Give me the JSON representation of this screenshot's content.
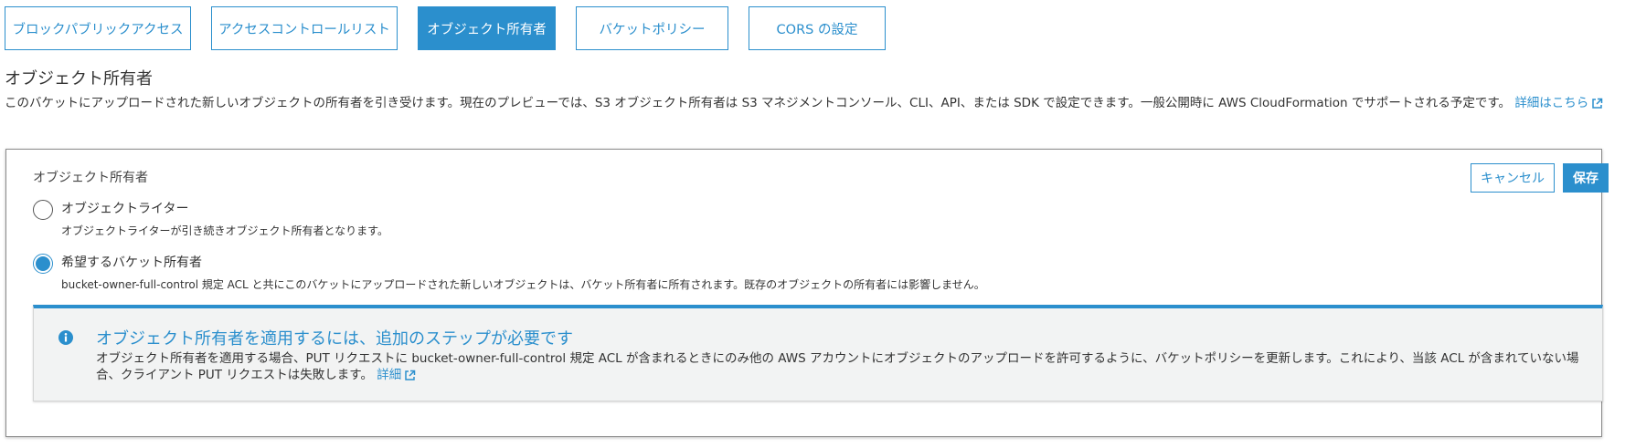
{
  "tabs": [
    {
      "label": "ブロックパブリックアクセス",
      "active": false
    },
    {
      "label": "アクセスコントロールリスト",
      "active": false
    },
    {
      "label": "オブジェクト所有者",
      "active": true
    },
    {
      "label": "バケットポリシー",
      "active": false
    },
    {
      "label": "CORS の設定",
      "active": false
    }
  ],
  "section": {
    "title": "オブジェクト所有者",
    "description": "このバケットにアップロードされた新しいオブジェクトの所有者を引き受けます。現在のプレビューでは、S3 オブジェクト所有者は S3 マネジメントコンソール、CLI、API、または SDK で設定できます。一般公開時に AWS CloudFormation でサポートされる予定です。",
    "learn_more_link": "詳細はこちら"
  },
  "panel": {
    "label": "オブジェクト所有者",
    "cancel_label": "キャンセル",
    "save_label": "保存",
    "options": [
      {
        "title": "オブジェクトライター",
        "description": "オブジェクトライターが引き続きオブジェクト所有者となります。",
        "selected": false
      },
      {
        "title": "希望するバケット所有者",
        "description": "bucket-owner-full-control 規定 ACL と共にこのバケットにアップロードされた新しいオブジェクトは、バケット所有者に所有されます。既存のオブジェクトの所有者には影響しません。",
        "selected": true
      }
    ]
  },
  "alert": {
    "icon": "info-icon",
    "title": "オブジェクト所有者を適用するには、追加のステップが必要です",
    "body": "オブジェクト所有者を適用する場合、PUT リクエストに bucket-owner-full-control 規定 ACL が含まれるときにのみ他の AWS アカウントにオブジェクトのアップロードを許可するように、バケットポリシーを更新します。これにより、当該 ACL が含まれていない場合、クライアント PUT リクエストは失敗します。",
    "link": "詳細"
  },
  "colors": {
    "accent": "#2b8fcd",
    "alert_bg": "#f2f3f3",
    "text": "#333333"
  }
}
